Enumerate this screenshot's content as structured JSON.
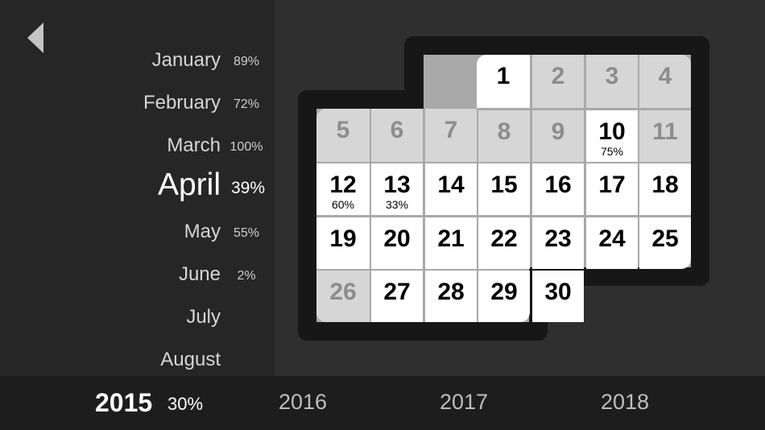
{
  "months": [
    {
      "name": "January",
      "pct": "89%"
    },
    {
      "name": "February",
      "pct": "72%"
    },
    {
      "name": "March",
      "pct": "100%"
    },
    {
      "name": "April",
      "pct": "39%",
      "selected": true
    },
    {
      "name": "May",
      "pct": "55%"
    },
    {
      "name": "June",
      "pct": "2%"
    },
    {
      "name": "July",
      "pct": ""
    },
    {
      "name": "August",
      "pct": ""
    }
  ],
  "calendar": {
    "days": [
      {
        "day": "1",
        "state": "on",
        "pct": ""
      },
      {
        "day": "2",
        "state": "off",
        "pct": ""
      },
      {
        "day": "3",
        "state": "off",
        "pct": ""
      },
      {
        "day": "4",
        "state": "off",
        "pct": ""
      },
      {
        "day": "5",
        "state": "off",
        "pct": ""
      },
      {
        "day": "6",
        "state": "off",
        "pct": ""
      },
      {
        "day": "7",
        "state": "off",
        "pct": ""
      },
      {
        "day": "8",
        "state": "off",
        "pct": ""
      },
      {
        "day": "9",
        "state": "off",
        "pct": ""
      },
      {
        "day": "10",
        "state": "on",
        "pct": "75%"
      },
      {
        "day": "11",
        "state": "off",
        "pct": ""
      },
      {
        "day": "12",
        "state": "on",
        "pct": "60%"
      },
      {
        "day": "13",
        "state": "on",
        "pct": "33%"
      },
      {
        "day": "14",
        "state": "on",
        "pct": ""
      },
      {
        "day": "15",
        "state": "on",
        "pct": ""
      },
      {
        "day": "16",
        "state": "on",
        "pct": ""
      },
      {
        "day": "17",
        "state": "on",
        "pct": ""
      },
      {
        "day": "18",
        "state": "on",
        "pct": ""
      },
      {
        "day": "19",
        "state": "on",
        "pct": ""
      },
      {
        "day": "20",
        "state": "on",
        "pct": ""
      },
      {
        "day": "21",
        "state": "on",
        "pct": ""
      },
      {
        "day": "22",
        "state": "on",
        "pct": ""
      },
      {
        "day": "23",
        "state": "on",
        "pct": ""
      },
      {
        "day": "24",
        "state": "on",
        "pct": ""
      },
      {
        "day": "25",
        "state": "on",
        "pct": ""
      },
      {
        "day": "26",
        "state": "off",
        "pct": ""
      },
      {
        "day": "27",
        "state": "on",
        "pct": ""
      },
      {
        "day": "28",
        "state": "on",
        "pct": ""
      },
      {
        "day": "29",
        "state": "on",
        "pct": ""
      },
      {
        "day": "30",
        "state": "on",
        "pct": ""
      }
    ]
  },
  "years": [
    {
      "label": "2015",
      "pct": "30%",
      "selected": true
    },
    {
      "label": "2016",
      "pct": ""
    },
    {
      "label": "2017",
      "pct": ""
    },
    {
      "label": "2018",
      "pct": ""
    }
  ],
  "colors": {
    "background": "#303030",
    "sidebar": "#262626",
    "year_bar": "#1d1d1d",
    "day_active": "#ffffff",
    "day_inactive": "#d6d6d6",
    "day_inactive_text": "#8d8d8d"
  },
  "icons": {
    "back": "left-triangle-icon"
  }
}
